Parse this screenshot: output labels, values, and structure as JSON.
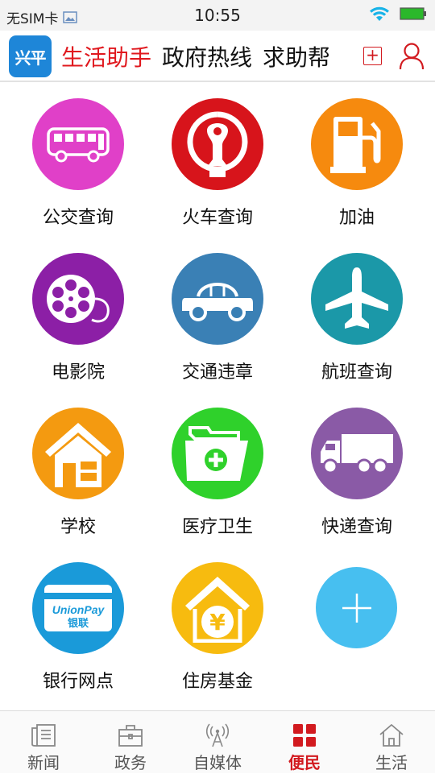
{
  "status_bar": {
    "carrier": "无SIM卡",
    "time": "10:55"
  },
  "header": {
    "logo_text": "兴平",
    "tabs": [
      {
        "label": "生活助手",
        "active": true
      },
      {
        "label": "政府热线",
        "active": false
      },
      {
        "label": "求助帮",
        "active": false
      }
    ],
    "add_label": "+"
  },
  "services": [
    {
      "label": "公交查询",
      "icon": "bus-icon",
      "color": "#e040c8"
    },
    {
      "label": "火车查询",
      "icon": "railway-icon",
      "color": "#d7141b"
    },
    {
      "label": "加油",
      "icon": "fuel-pump-icon",
      "color": "#f68a0e"
    },
    {
      "label": "电影院",
      "icon": "film-reel-icon",
      "color": "#8c1fa6"
    },
    {
      "label": "交通违章",
      "icon": "car-icon",
      "color": "#3a80b5"
    },
    {
      "label": "航班查询",
      "icon": "airplane-icon",
      "color": "#1b98a8"
    },
    {
      "label": "学校",
      "icon": "school-house-icon",
      "color": "#f49a10"
    },
    {
      "label": "医疗卫生",
      "icon": "medical-folder-icon",
      "color": "#2fd12b"
    },
    {
      "label": "快递查询",
      "icon": "delivery-truck-icon",
      "color": "#8a5aa6"
    },
    {
      "label": "银行网点",
      "icon": "bank-card-icon",
      "color": "#1a9ad9"
    },
    {
      "label": "住房基金",
      "icon": "housing-fund-icon",
      "color": "#f7bb0f"
    }
  ],
  "bank_card": {
    "brand": "UnionPay",
    "brand_cn": "银联"
  },
  "housing_symbol": "¥",
  "bottom_nav": [
    {
      "label": "新闻",
      "icon": "news-icon",
      "active": false
    },
    {
      "label": "政务",
      "icon": "briefcase-icon",
      "active": false
    },
    {
      "label": "自媒体",
      "icon": "broadcast-icon",
      "active": false
    },
    {
      "label": "便民",
      "icon": "grid-icon",
      "active": true
    },
    {
      "label": "生活",
      "icon": "home-icon",
      "active": false
    }
  ]
}
